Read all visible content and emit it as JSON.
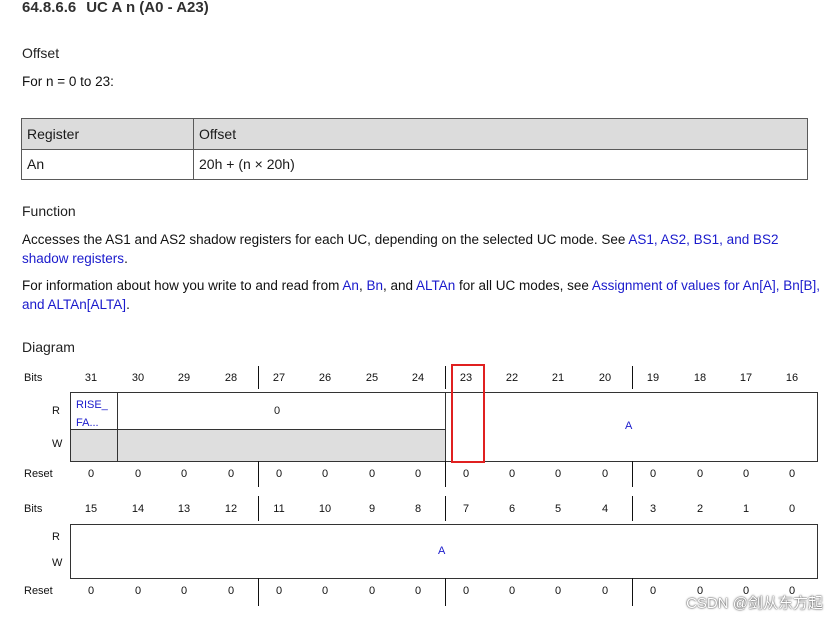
{
  "heading": {
    "number": "64.8.6.6",
    "title": "UC A n (A0 - A23)"
  },
  "offset": {
    "label": "Offset",
    "range_text": "For n = 0 to 23:",
    "table": {
      "headers": [
        "Register",
        "Offset"
      ],
      "rows": [
        [
          "An",
          "20h + (n × 20h)"
        ]
      ]
    }
  },
  "function": {
    "label": "Function",
    "p1_text": "Accesses the AS1 and AS2 shadow registers for each UC, depending on the selected UC mode. See ",
    "p1_link": "AS1, AS2, BS1, and BS2 shadow registers",
    "p1_end": ".",
    "p2_text": "For information about how you write to and read from ",
    "p2_an": "An",
    "p2_comma1": ", ",
    "p2_bn": "Bn",
    "p2_and": ", and ",
    "p2_altan": "ALTAn",
    "p2_rest": " for all UC modes, see ",
    "p2_link": "Assignment of values for An[A], Bn[B], and ALTAn[ALTA]",
    "p2_end": "."
  },
  "diagram": {
    "label": "Diagram",
    "row_labels": {
      "bits": "Bits",
      "r": "R",
      "w": "W",
      "reset": "Reset"
    },
    "upper_bits": [
      "31",
      "30",
      "29",
      "28",
      "27",
      "26",
      "25",
      "24",
      "23",
      "22",
      "21",
      "20",
      "19",
      "18",
      "17",
      "16"
    ],
    "lower_bits": [
      "15",
      "14",
      "13",
      "12",
      "11",
      "10",
      "9",
      "8",
      "7",
      "6",
      "5",
      "4",
      "3",
      "2",
      "1",
      "0"
    ],
    "upper_reset": [
      "0",
      "0",
      "0",
      "0",
      "0",
      "0",
      "0",
      "0",
      "0",
      "0",
      "0",
      "0",
      "0",
      "0",
      "0",
      "0"
    ],
    "lower_reset": [
      "0",
      "0",
      "0",
      "0",
      "0",
      "0",
      "0",
      "0",
      "0",
      "0",
      "0",
      "0",
      "0",
      "0",
      "0",
      "0"
    ],
    "fields": {
      "rise_fa": "RISE_\nFA...",
      "reserved_value": "0",
      "a_upper": "A",
      "a_lower": "A"
    },
    "colors": {
      "reserved_fill": "#dedede",
      "highlight": "#e02020",
      "link": "#1a1acc"
    }
  },
  "watermark": "CSDN @剑从东方起"
}
